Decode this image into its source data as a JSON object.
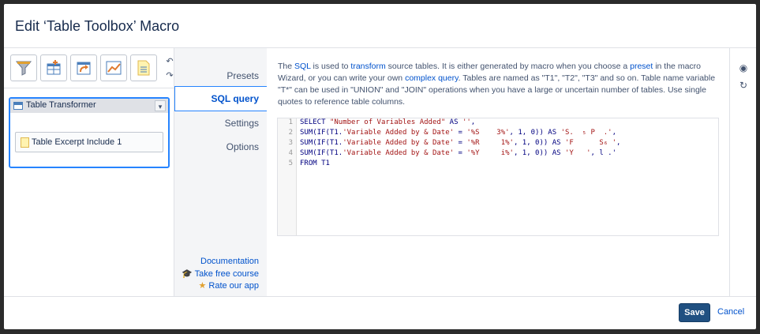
{
  "dialog": {
    "title": "Edit ‘Table Toolbox’ Macro"
  },
  "toolbar": {
    "tools": [
      {
        "icon": "filter-funnel-icon",
        "color": "#e0a030"
      },
      {
        "icon": "table-add-icon",
        "color": "#4a7ebb"
      },
      {
        "icon": "table-pivot-icon",
        "color": "#e07a2f"
      },
      {
        "icon": "chart-icon",
        "color": "#e07a2f"
      },
      {
        "icon": "table-excerpt-icon",
        "color": "#e0b84f"
      }
    ],
    "undo_icon": "undo-icon",
    "redo_icon": "redo-icon"
  },
  "macro_tree": {
    "transformer_label": "Table Transformer",
    "excerpt_label": "Table Excerpt Include 1"
  },
  "nav": {
    "items": [
      "Presets",
      "SQL query",
      "Settings",
      "Options"
    ],
    "active": "SQL query",
    "links": [
      "Documentation",
      "Take free course",
      "Rate our app"
    ]
  },
  "main": {
    "desc_1": "The ",
    "desc_sql": "SQL",
    "desc_2": " is used to ",
    "desc_transform": "transform",
    "desc_3": " source tables. It is either generated by macro when you choose a ",
    "desc_preset": "preset",
    "desc_4": " in the macro Wizard, or you can write your own ",
    "desc_complex": "complex query",
    "desc_5": ". Tables are named as \"T1\", \"T2\", \"T3\" and so on. Table name variable \"T*\" can be used in \"UNION\" and \"JOIN\" operations when you have a large or uncertain number of tables. Use single quotes to reference table columns.",
    "code_lines": [
      "SELECT \"Number of Variables Added\" AS '',",
      "SUM(IF(T1.'Variable Added by & Date' = '%S    3%', 1, 0)) AS 'S.  ₅ P  .',",
      "SUM(IF(T1.'Variable Added by & Date' = '%R     1%', 1, 0)) AS 'F      S₆ ',",
      "SUM(IF(T1.'Variable Added by & Date' = '%Y     i%', 1, 0)) AS 'Y   ', l .'",
      "FROM T1"
    ],
    "line_numbers": [
      "1",
      "2",
      "3",
      "4",
      "5"
    ]
  },
  "right_rail": {
    "preview_icon": "eye-icon",
    "refresh_icon": "refresh-icon"
  },
  "footer": {
    "save_label": "Save",
    "cancel_label": "Cancel"
  }
}
